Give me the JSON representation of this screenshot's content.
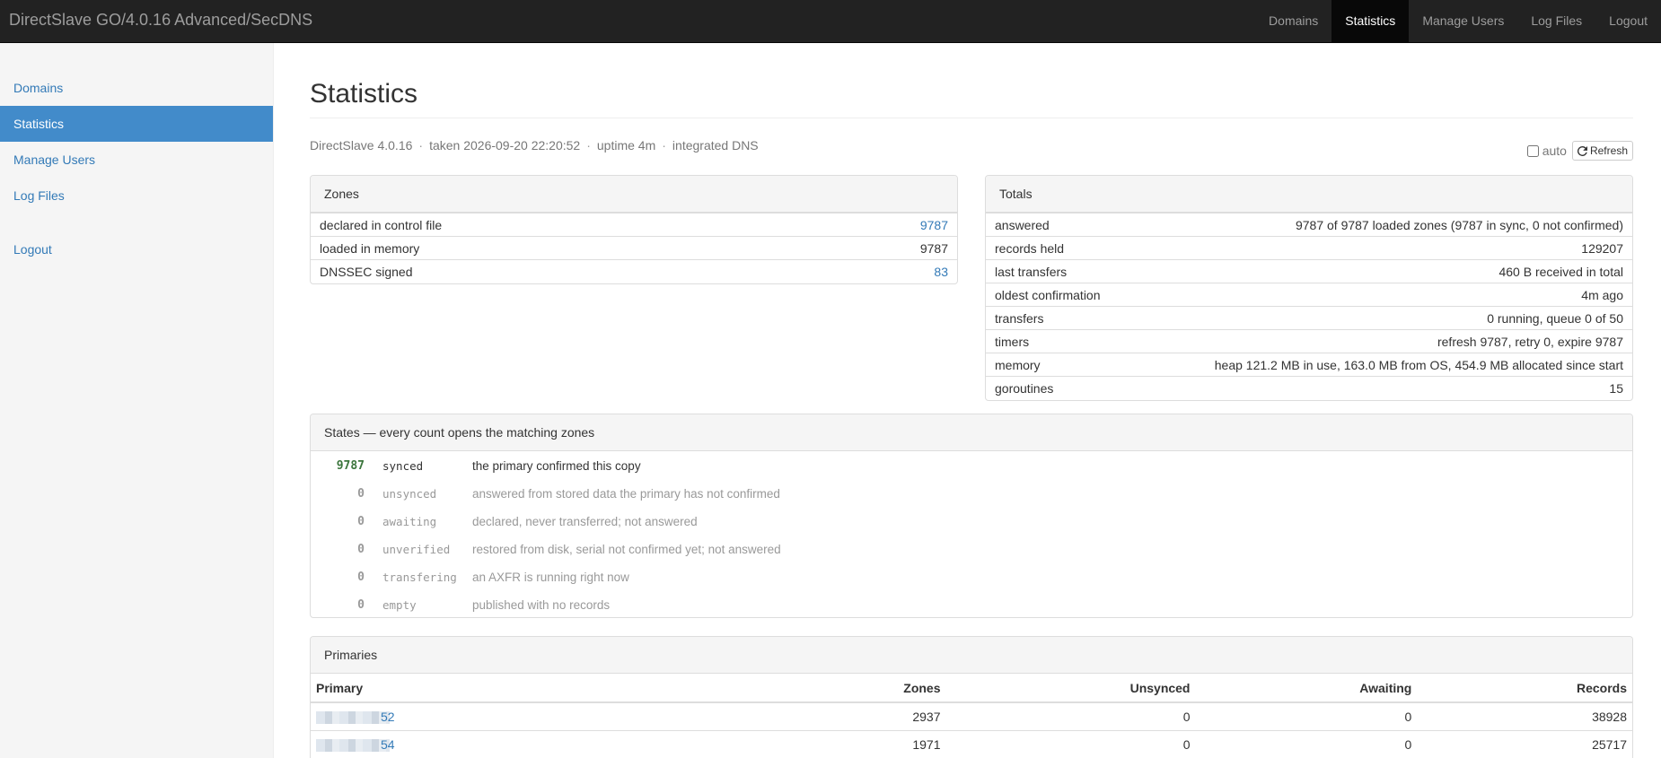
{
  "brand": "DirectSlave GO/4.0.16 Advanced/SecDNS",
  "topnav": [
    "Domains",
    "Statistics",
    "Manage Users",
    "Log Files",
    "Logout"
  ],
  "sidebar": {
    "items": [
      "Domains",
      "Statistics",
      "Manage Users",
      "Log Files"
    ],
    "logout": "Logout"
  },
  "page_title": "Statistics",
  "meta": {
    "version": "DirectSlave 4.0.16",
    "taken": "taken 2026-09-20 22:20:52",
    "uptime": "uptime 4m",
    "dns": "integrated DNS",
    "sep": "·",
    "auto_label": "auto",
    "refresh_label": "Refresh"
  },
  "zones": {
    "title": "Zones",
    "rows": [
      {
        "k": "declared in control file",
        "v": "9787"
      },
      {
        "k": "loaded in memory",
        "v": "9787"
      },
      {
        "k": "DNSSEC signed",
        "v": "83"
      }
    ]
  },
  "totals": {
    "title": "Totals",
    "rows": [
      {
        "k": "answered",
        "v": "9787 of 9787 loaded zones (9787 in sync, 0 not confirmed)"
      },
      {
        "k": "records held",
        "v": "129207"
      },
      {
        "k": "last transfers",
        "v": "460 B received in total"
      },
      {
        "k": "oldest confirmation",
        "v": "4m ago"
      },
      {
        "k": "transfers",
        "v": "0 running, queue 0 of 50"
      },
      {
        "k": "timers",
        "v": "refresh 9787, retry 0, expire 9787"
      },
      {
        "k": "memory",
        "v": "heap 121.2 MB in use, 163.0 MB from OS, 454.9 MB allocated since start"
      },
      {
        "k": "goroutines",
        "v": "15"
      }
    ]
  },
  "states": {
    "title": "States — every count opens the matching zones",
    "rows": [
      {
        "n": "9787",
        "s": "synced",
        "d": "the primary confirmed this copy"
      },
      {
        "n": "0",
        "s": "unsynced",
        "d": "answered from stored data the primary has not confirmed"
      },
      {
        "n": "0",
        "s": "awaiting",
        "d": "declared, never transferred; not answered"
      },
      {
        "n": "0",
        "s": "unverified",
        "d": "restored from disk, serial not confirmed yet; not answered"
      },
      {
        "n": "0",
        "s": "transfering",
        "d": "an AXFR is running right now"
      },
      {
        "n": "0",
        "s": "empty",
        "d": "published with no records"
      }
    ]
  },
  "primaries": {
    "title": "Primaries",
    "headers": [
      "Primary",
      "Zones",
      "Unsynced",
      "Awaiting",
      "Records"
    ],
    "rows": [
      {
        "ip": "52",
        "zones": "2937",
        "unsynced": "0",
        "awaiting": "0",
        "records": "38928"
      },
      {
        "ip": "54",
        "zones": "1971",
        "unsynced": "0",
        "awaiting": "0",
        "records": "25717"
      }
    ]
  }
}
